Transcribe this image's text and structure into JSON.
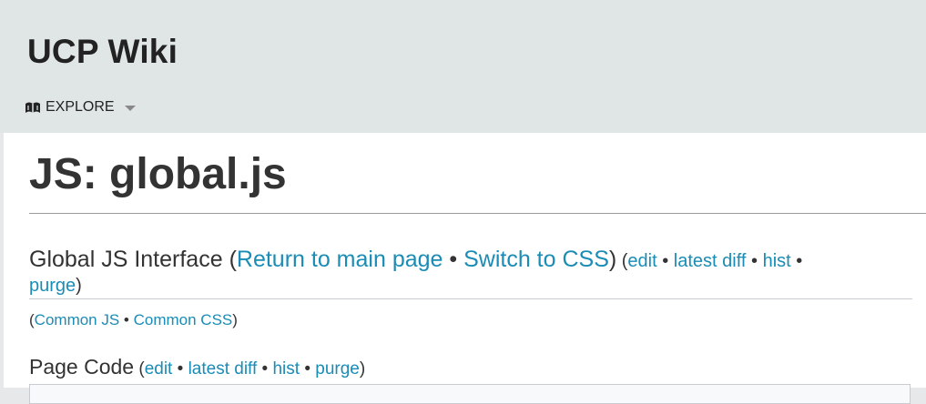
{
  "header": {
    "wiki_name": "UCP Wiki",
    "explore_label": "EXPLORE",
    "explore_icon": "book-icon"
  },
  "page": {
    "title": "JS: global.js"
  },
  "interface": {
    "heading": "Global JS Interface",
    "open_paren": " (",
    "return_link": "Return to main page",
    "bullet": " • ",
    "switch_link": "Switch to CSS",
    "close_paren": ")",
    "tools_open": " (",
    "edit": "edit",
    "latest_diff": "latest diff",
    "hist": "hist",
    "purge": "purge",
    "tools_close": ")"
  },
  "common": {
    "open": "(",
    "common_js": "Common JS",
    "common_css": "Common CSS",
    "close": ")"
  },
  "page_code": {
    "heading": "Page Code",
    "edit": "edit",
    "latest_diff": "latest diff",
    "hist": "hist",
    "purge": "purge"
  },
  "colors": {
    "link": "#1a8cb5",
    "header_bg": "#dfe6e5",
    "text": "#333333"
  }
}
